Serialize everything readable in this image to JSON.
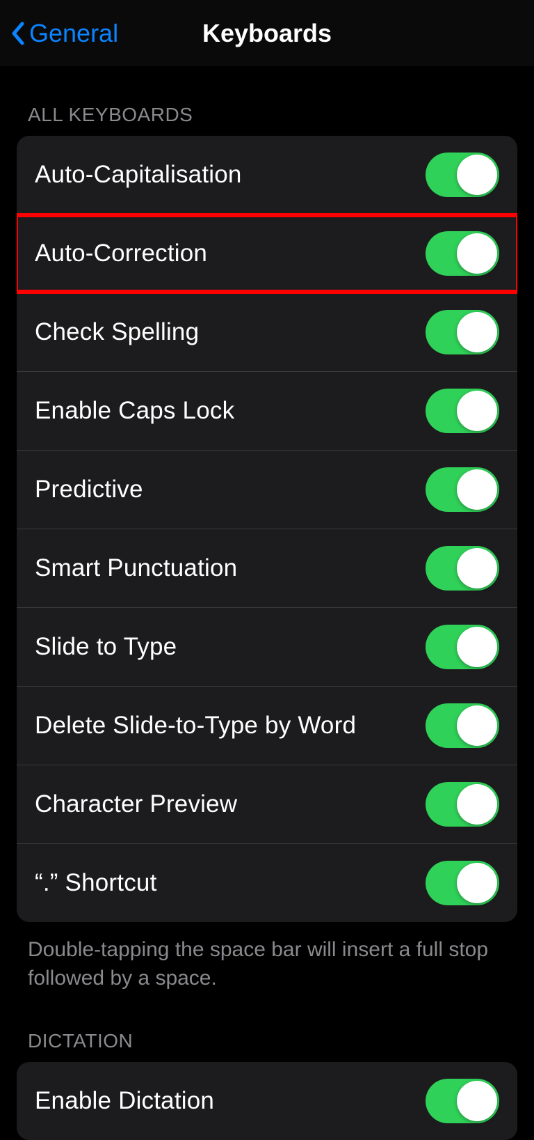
{
  "nav": {
    "back_label": "General",
    "title": "Keyboards"
  },
  "sections": {
    "all_keyboards": {
      "header": "ALL KEYBOARDS",
      "footer": "Double-tapping the space bar will insert a full stop followed by a space.",
      "rows": [
        {
          "label": "Auto-Capitalisation",
          "on": true,
          "highlighted": false
        },
        {
          "label": "Auto-Correction",
          "on": true,
          "highlighted": true
        },
        {
          "label": "Check Spelling",
          "on": true,
          "highlighted": false
        },
        {
          "label": "Enable Caps Lock",
          "on": true,
          "highlighted": false
        },
        {
          "label": "Predictive",
          "on": true,
          "highlighted": false
        },
        {
          "label": "Smart Punctuation",
          "on": true,
          "highlighted": false
        },
        {
          "label": "Slide to Type",
          "on": true,
          "highlighted": false
        },
        {
          "label": "Delete Slide-to-Type by Word",
          "on": true,
          "highlighted": false
        },
        {
          "label": "Character Preview",
          "on": true,
          "highlighted": false
        },
        {
          "label": "“.” Shortcut",
          "on": true,
          "highlighted": false
        }
      ]
    },
    "dictation": {
      "header": "DICTATION",
      "rows": [
        {
          "label": "Enable Dictation",
          "on": true,
          "highlighted": false
        }
      ]
    }
  },
  "colors": {
    "accent": "#0a84ff",
    "toggle_on": "#30d158",
    "highlight": "#ff0000"
  }
}
